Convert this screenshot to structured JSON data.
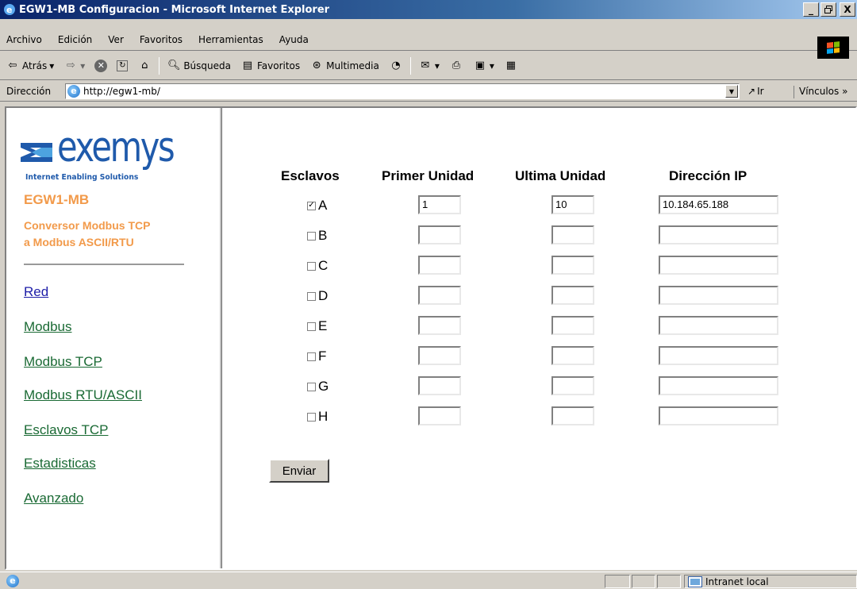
{
  "window": {
    "title": "EGW1-MB Configuracion - Microsoft Internet Explorer",
    "min_label": "_",
    "max_label": "И",
    "close_label": "X"
  },
  "menu": {
    "items": [
      "Archivo",
      "Edición",
      "Ver",
      "Favoritos",
      "Herramientas",
      "Ayuda"
    ]
  },
  "toolbar": {
    "back_label": "Atrás",
    "search_label": "Búsqueda",
    "favorites_label": "Favoritos",
    "media_label": "Multimedia"
  },
  "address": {
    "label": "Dirección",
    "url": "http://egw1-mb/",
    "go_label": "Ir",
    "links_label": "Vínculos »"
  },
  "sidebar": {
    "logo_word": "exemys",
    "logo_tagline": "Internet Enabling Solutions",
    "product_name": "EGW1-MB",
    "product_desc_line1": "Conversor Modbus TCP",
    "product_desc_line2": "a Modbus ASCII/RTU",
    "nav": [
      "Red",
      "Modbus",
      "Modbus TCP",
      "Modbus RTU/ASCII",
      "Esclavos TCP",
      "Estadisticas",
      "Avanzado"
    ]
  },
  "form": {
    "headers": {
      "slaves": "Esclavos",
      "first_unit": "Primer Unidad",
      "last_unit": "Ultima Unidad",
      "ip": "Dirección IP"
    },
    "rows": [
      {
        "label": "A",
        "checked": true,
        "first": "1",
        "last": "10",
        "ip": "10.184.65.188"
      },
      {
        "label": "B",
        "checked": false,
        "first": "",
        "last": "",
        "ip": ""
      },
      {
        "label": "C",
        "checked": false,
        "first": "",
        "last": "",
        "ip": ""
      },
      {
        "label": "D",
        "checked": false,
        "first": "",
        "last": "",
        "ip": ""
      },
      {
        "label": "E",
        "checked": false,
        "first": "",
        "last": "",
        "ip": ""
      },
      {
        "label": "F",
        "checked": false,
        "first": "",
        "last": "",
        "ip": ""
      },
      {
        "label": "G",
        "checked": false,
        "first": "",
        "last": "",
        "ip": ""
      },
      {
        "label": "H",
        "checked": false,
        "first": "",
        "last": "",
        "ip": ""
      }
    ],
    "submit_label": "Enviar"
  },
  "status": {
    "zone_label": "Intranet local"
  },
  "colors": {
    "accent_orange": "#f29a4a",
    "link_green": "#1a6a34",
    "link_blue": "#1d1da8",
    "logo_blue": "#1f5aab"
  }
}
